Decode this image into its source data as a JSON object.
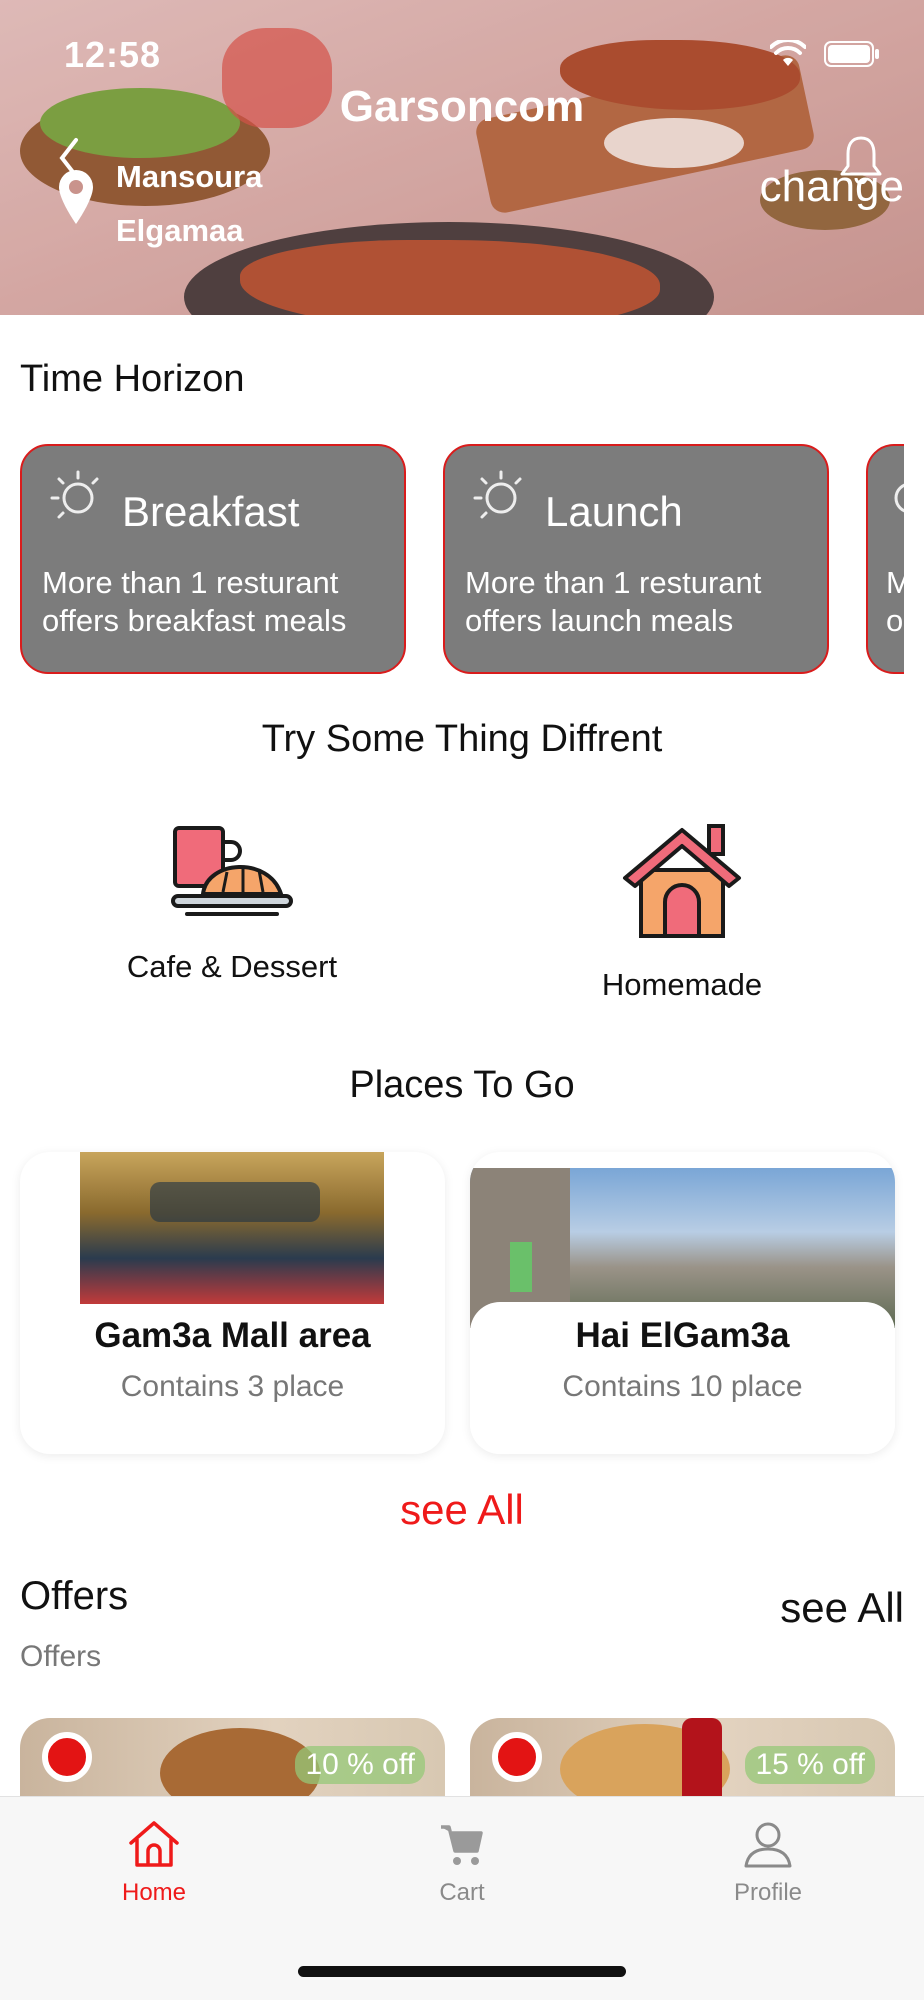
{
  "status_bar": {
    "time": "12:58"
  },
  "header": {
    "title": "Garsoncom",
    "location_line1": "Mansoura",
    "location_line2": "Elgamaa",
    "change_label": "change"
  },
  "time_horizon": {
    "title": "Time Horizon",
    "cards": [
      {
        "title": "Breakfast",
        "desc_line1": "More than 1 resturant",
        "desc_line2": "offers  breakfast meals"
      },
      {
        "title": "Launch",
        "desc_line1": "More than 1 resturant",
        "desc_line2": "offers  launch meals"
      },
      {
        "title": "",
        "desc_line1": "M",
        "desc_line2": "o"
      }
    ]
  },
  "try_different": {
    "title": "Try Some Thing Diffrent",
    "items": [
      {
        "label": "Cafe & Dessert",
        "icon": "cafe-dessert-icon"
      },
      {
        "label": "Homemade",
        "icon": "house-icon"
      }
    ]
  },
  "places": {
    "title": "Places To Go",
    "cards": [
      {
        "name": "Gam3a Mall area",
        "subtitle": "Contains 3 place"
      },
      {
        "name": "Hai ElGam3a",
        "subtitle": "Contains 10 place"
      }
    ],
    "see_all": "see All"
  },
  "offers": {
    "title": "Offers",
    "subtitle": "Offers",
    "see_all": "see All",
    "cards": [
      {
        "discount": "10 % off"
      },
      {
        "discount": "15 % off"
      }
    ]
  },
  "tabbar": {
    "tabs": [
      {
        "label": "Home",
        "icon": "home-icon",
        "active": true
      },
      {
        "label": "Cart",
        "icon": "cart-icon",
        "active": false
      },
      {
        "label": "Profile",
        "icon": "profile-icon",
        "active": false
      }
    ]
  },
  "colors": {
    "accent": "#ef1a1a",
    "card_gray": "#7c7c7c",
    "tab_inactive": "#8a8a8a"
  }
}
